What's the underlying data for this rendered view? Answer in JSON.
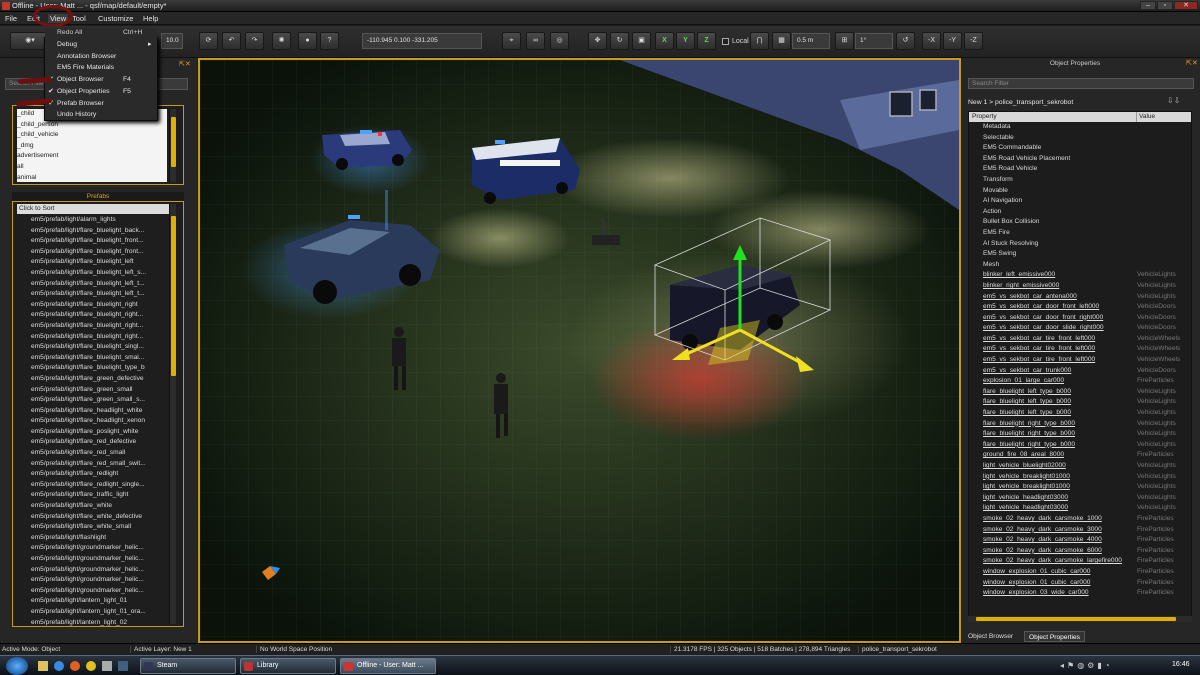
{
  "window": {
    "title": "Offline - User: Matt ... - qsf/map/default/empty*",
    "buttons": [
      "–",
      "▫",
      "✕"
    ]
  },
  "menu": {
    "items": [
      "File",
      "Edit",
      "View",
      "Tool",
      "Customize",
      "Help"
    ]
  },
  "view_menu": {
    "items": [
      {
        "label": "Debug",
        "shortcut": "",
        "checked": false,
        "submenu": true
      },
      {
        "label": "Annotation Browser",
        "shortcut": "",
        "checked": false
      },
      {
        "label": "EM5 Fire Materials",
        "shortcut": "",
        "checked": false
      },
      {
        "label": "Object Browser",
        "shortcut": "F4",
        "checked": true
      },
      {
        "label": "Object Properties",
        "shortcut": "F5",
        "checked": true
      },
      {
        "label": "Prefab Browser",
        "shortcut": "",
        "checked": true
      },
      {
        "label": "Undo History",
        "shortcut": "",
        "checked": false
      }
    ],
    "hidden_item": {
      "label": "Redo All",
      "shortcut": "Ctrl+H"
    }
  },
  "toolbar": {
    "speed_value": "10.0",
    "position_value": "-110.945 0.100 -331.205",
    "axis_x": "X",
    "axis_y": "Y",
    "axis_z": "Z",
    "local_label": "Local",
    "snap_value": "0.5 m",
    "angle_value": "1°",
    "neg_x": "-X",
    "neg_y": "-Y",
    "neg_z": "-Z",
    "help": "?"
  },
  "left_panel": {
    "search_placeholder": "Search Filter",
    "layers": [
      "_child",
      "_child_person",
      "_child_vehicle",
      "_dmg",
      "advertisement",
      "all",
      "animal"
    ],
    "prefabs_header": "Prefabs",
    "sort_label": "Click to Sort",
    "prefabs": [
      "em5/prefab/light/alarm_lights",
      "em5/prefab/light/flare_bluelight_back...",
      "em5/prefab/light/flare_bluelight_front...",
      "em5/prefab/light/flare_bluelight_front...",
      "em5/prefab/light/flare_bluelight_left",
      "em5/prefab/light/flare_bluelight_left_s...",
      "em5/prefab/light/flare_bluelight_left_t...",
      "em5/prefab/light/flare_bluelight_left_t...",
      "em5/prefab/light/flare_bluelight_right",
      "em5/prefab/light/flare_bluelight_right...",
      "em5/prefab/light/flare_bluelight_right...",
      "em5/prefab/light/flare_bluelight_right...",
      "em5/prefab/light/flare_bluelight_singl...",
      "em5/prefab/light/flare_bluelight_smal...",
      "em5/prefab/light/flare_bluelight_type_b",
      "em5/prefab/light/flare_green_defective",
      "em5/prefab/light/flare_green_small",
      "em5/prefab/light/flare_green_small_s...",
      "em5/prefab/light/flare_headlight_white",
      "em5/prefab/light/flare_headlight_xenon",
      "em5/prefab/light/flare_poslight_white",
      "em5/prefab/light/flare_red_defective",
      "em5/prefab/light/flare_red_small",
      "em5/prefab/light/flare_red_small_swit...",
      "em5/prefab/light/flare_redlight",
      "em5/prefab/light/flare_redlight_single...",
      "em5/prefab/light/flare_traffic_light",
      "em5/prefab/light/flare_white",
      "em5/prefab/light/flare_white_defective",
      "em5/prefab/light/flare_white_small",
      "em5/prefab/light/flashlight",
      "em5/prefab/light/groundmarker_helic...",
      "em5/prefab/light/groundmarker_helic...",
      "em5/prefab/light/groundmarker_helic...",
      "em5/prefab/light/groundmarker_helic...",
      "em5/prefab/light/groundmarker_helic...",
      "em5/prefab/light/lantern_light_01",
      "em5/prefab/light/lantern_light_01_ora...",
      "em5/prefab/light/lantern_light_02"
    ]
  },
  "right_panel": {
    "header": "Object Properties",
    "search_placeholder": "Search Filter",
    "breadcrumb": "New 1 > police_transport_sekrobot",
    "col_property": "Property",
    "col_value": "Value",
    "properties": [
      {
        "name": "Metadata",
        "value": "",
        "link": false
      },
      {
        "name": "Selectable",
        "value": "",
        "link": false
      },
      {
        "name": "EM5 Commandable",
        "value": "",
        "link": false
      },
      {
        "name": "EM5 Road Vehicle Placement",
        "value": "",
        "link": false
      },
      {
        "name": "EM5 Road Vehicle",
        "value": "",
        "link": false
      },
      {
        "name": "Transform",
        "value": "",
        "link": false
      },
      {
        "name": "Movable",
        "value": "",
        "link": false
      },
      {
        "name": "AI Navigation",
        "value": "",
        "link": false
      },
      {
        "name": "Action",
        "value": "",
        "link": false
      },
      {
        "name": "Bullet Box Collision",
        "value": "",
        "link": false
      },
      {
        "name": "EM5 Fire",
        "value": "",
        "link": false
      },
      {
        "name": "AI Stuck Resolving",
        "value": "",
        "link": false
      },
      {
        "name": "EM5 Swing",
        "value": "",
        "link": false
      },
      {
        "name": "Mesh",
        "value": "",
        "link": false
      },
      {
        "name": "blinker_left_emissive000",
        "value": "VehicleLights",
        "link": true
      },
      {
        "name": "blinker_right_emissive000",
        "value": "VehicleLights",
        "link": true
      },
      {
        "name": "em5_vs_sekbot_car_antena000",
        "value": "VehicleLights",
        "link": true
      },
      {
        "name": "em5_vs_sekbot_car_door_front_left000",
        "value": "VehicleDoors",
        "link": true
      },
      {
        "name": "em5_vs_sekbot_car_door_front_right000",
        "value": "VehicleDoors",
        "link": true
      },
      {
        "name": "em5_vs_sekbot_car_door_slide_right000",
        "value": "VehicleDoors",
        "link": true
      },
      {
        "name": "em5_vs_sekbot_car_tire_front_left000",
        "value": "VehicleWheels",
        "link": true
      },
      {
        "name": "em5_vs_sekbot_car_tire_front_left000",
        "value": "VehicleWheels",
        "link": true
      },
      {
        "name": "em5_vs_sekbot_car_tire_front_left000",
        "value": "VehicleWheels",
        "link": true
      },
      {
        "name": "em5_vs_sekbot_car_trunk000",
        "value": "VehicleDoors",
        "link": true
      },
      {
        "name": "explosion_01_large_car000",
        "value": "FireParticles",
        "link": true
      },
      {
        "name": "flare_bluelight_left_type_b000",
        "value": "VehicleLights",
        "link": true
      },
      {
        "name": "flare_bluelight_left_type_b000",
        "value": "VehicleLights",
        "link": true
      },
      {
        "name": "flare_bluelight_left_type_b000",
        "value": "VehicleLights",
        "link": true
      },
      {
        "name": "flare_bluelight_right_type_b000",
        "value": "VehicleLights",
        "link": true
      },
      {
        "name": "flare_bluelight_right_type_b000",
        "value": "VehicleLights",
        "link": true
      },
      {
        "name": "flare_bluelight_right_type_b000",
        "value": "VehicleLights",
        "link": true
      },
      {
        "name": "ground_fire_08_areal_8000",
        "value": "FireParticles",
        "link": true
      },
      {
        "name": "light_vehicle_bluelight02000",
        "value": "VehicleLights",
        "link": true
      },
      {
        "name": "light_vehicle_breaklight01000",
        "value": "VehicleLights",
        "link": true
      },
      {
        "name": "light_vehicle_breaklight01000",
        "value": "VehicleLights",
        "link": true
      },
      {
        "name": "light_vehicle_headlight03000",
        "value": "VehicleLights",
        "link": true
      },
      {
        "name": "light_vehicle_headlight03000",
        "value": "VehicleLights",
        "link": true
      },
      {
        "name": "smoke_02_heavy_dark_carsmoke_1000",
        "value": "FireParticles",
        "link": true
      },
      {
        "name": "smoke_02_heavy_dark_carsmoke_3000",
        "value": "FireParticles",
        "link": true
      },
      {
        "name": "smoke_02_heavy_dark_carsmoke_4000",
        "value": "FireParticles",
        "link": true
      },
      {
        "name": "smoke_02_heavy_dark_carsmoke_6000",
        "value": "FireParticles",
        "link": true
      },
      {
        "name": "smoke_02_heavy_dark_carsmoke_largefire000",
        "value": "FireParticles",
        "link": true
      },
      {
        "name": "window_explosion_01_cubic_car000",
        "value": "FireParticles",
        "link": true
      },
      {
        "name": "window_explosion_01_cubic_car000",
        "value": "FireParticles",
        "link": true
      },
      {
        "name": "window_explosion_03_wide_car000",
        "value": "FireParticles",
        "link": true
      }
    ],
    "tabs": [
      "Object Browser",
      "Object Properties"
    ]
  },
  "status": {
    "mode": "Active Mode: Object",
    "layer": "Active Layer: New 1",
    "world": "No World Space Position",
    "stats": "21.3178 FPS | 325 Objects | 518 Batches | 278,894 Triangles",
    "selected": "police_transport_sekrobot"
  },
  "taskbar": {
    "tasks": [
      "Steam",
      "Library",
      "Offline - User: Matt ..."
    ],
    "clock": "16:46"
  },
  "colors": {
    "accent": "#c89a1a",
    "scroll": "#e0b000",
    "gizmo_x": "#f0e020",
    "gizmo_y": "#20e020",
    "highlight": "#8b1a1a"
  }
}
